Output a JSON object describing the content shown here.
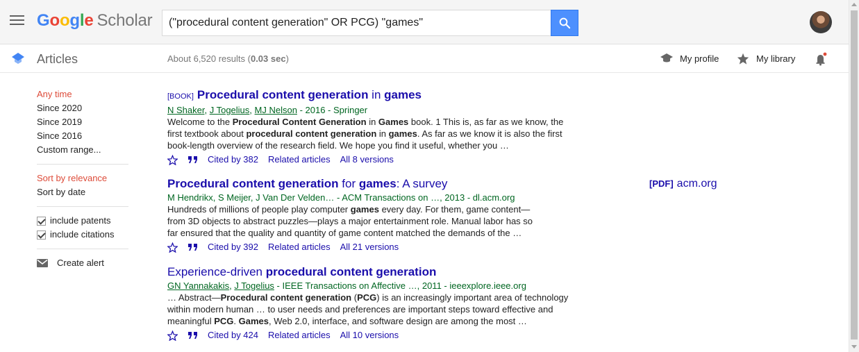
{
  "header": {
    "logo_google": [
      "G",
      "o",
      "o",
      "g",
      "l",
      "e"
    ],
    "logo_scholar": "Scholar",
    "search_value": "(\"procedural content generation\" OR PCG) \"games\""
  },
  "subbar": {
    "section": "Articles",
    "results_prefix": "About 6,520 results (",
    "results_time": "0.03 sec",
    "results_suffix": ")",
    "my_profile": "My profile",
    "my_library": "My library"
  },
  "sidebar": {
    "time_filters": [
      "Any time",
      "Since 2020",
      "Since 2019",
      "Since 2016",
      "Custom range..."
    ],
    "sort_options": [
      "Sort by relevance",
      "Sort by date"
    ],
    "include_patents": "include patents",
    "include_citations": "include citations",
    "create_alert": "Create alert"
  },
  "results": [
    {
      "tag": "[BOOK]",
      "title_parts": [
        {
          "t": "Procedural content generation",
          "b": true
        },
        {
          "t": " in ",
          "b": false
        },
        {
          "t": "games",
          "b": true
        }
      ],
      "authors": [
        "N Shaker",
        "J Togelius",
        "MJ Nelson"
      ],
      "meta_rest": " - 2016 - Springer",
      "snippet": [
        "Welcome to the ",
        {
          "b": "Procedural Content Generation"
        },
        " in ",
        {
          "b": "Games"
        },
        " book. 1 This is, as far as we know, the first textbook about ",
        {
          "b": "procedural content generation"
        },
        " in ",
        {
          "b": "games"
        },
        ". As far as we know it is also the first book-length overview of the research field. We hope you find it useful, whether you …"
      ],
      "cited_by": "Cited by 382",
      "related": "Related articles",
      "versions": "All 8 versions"
    },
    {
      "tag": "",
      "title_parts": [
        {
          "t": "Procedural content generation",
          "b": true
        },
        {
          "t": " for ",
          "b": false
        },
        {
          "t": "games",
          "b": true
        },
        {
          "t": ": A survey",
          "b": false
        }
      ],
      "authors": [],
      "meta_rest": "M Hendrikx, S Meijer, J Van Der Velden… - ACM Transactions on …, 2013 - dl.acm.org",
      "snippet": [
        "Hundreds of millions of people play computer ",
        {
          "b": "games"
        },
        " every day. For them, game content—from 3D objects to abstract puzzles—plays a major entertainment role. Manual labor has so far ensured that the quality and quantity of game content matched the demands of the …"
      ],
      "cited_by": "Cited by 392",
      "related": "Related articles",
      "versions": "All 21 versions"
    },
    {
      "tag": "",
      "title_parts": [
        {
          "t": "Experience-driven ",
          "b": false
        },
        {
          "t": "procedural content generation",
          "b": true
        }
      ],
      "authors": [
        "GN Yannakakis",
        "J Togelius"
      ],
      "meta_rest": " - IEEE Transactions on Affective …, 2011 - ieeexplore.ieee.org",
      "snippet": [
        "… Abstract—",
        {
          "b": "Procedural content generation"
        },
        " (",
        {
          "b": "PCG"
        },
        ") is an increasingly important area of technology within modern human … to user needs and preferences are important steps toward effective and meaningful ",
        {
          "b": "PCG"
        },
        ". ",
        {
          "b": "Games"
        },
        ", Web 2.0, interface, and software design are among the most …"
      ],
      "cited_by": "Cited by 424",
      "related": "Related articles",
      "versions": "All 10 versions"
    }
  ],
  "side_pdf": {
    "tag": "[PDF]",
    "source": "acm.org"
  },
  "colors": {
    "link": "#1a0dab",
    "meta_green": "#006621",
    "active_red": "#dd4b39",
    "search_blue": "#4d90fe"
  },
  "icons": [
    "menu-icon",
    "search-icon",
    "scholar-cap-icon",
    "graduation-cap-icon",
    "star-icon",
    "bell-icon",
    "mail-icon",
    "quote-icon"
  ]
}
